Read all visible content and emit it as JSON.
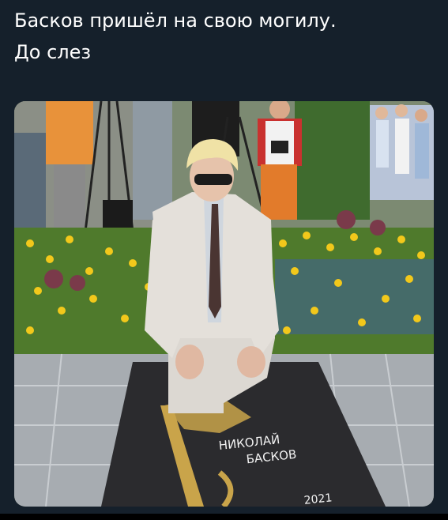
{
  "post": {
    "line1": "Басков пришёл на свою могилу.",
    "line2": "До слез"
  },
  "photo": {
    "plaque_first_name": "НИКОЛАЙ",
    "plaque_last_name": "БАСКОВ",
    "plaque_year": "2021"
  },
  "colors": {
    "background": "#15202b",
    "text": "#ffffff",
    "plaque": "#2b2b2e",
    "gold": "#c9a44a"
  }
}
